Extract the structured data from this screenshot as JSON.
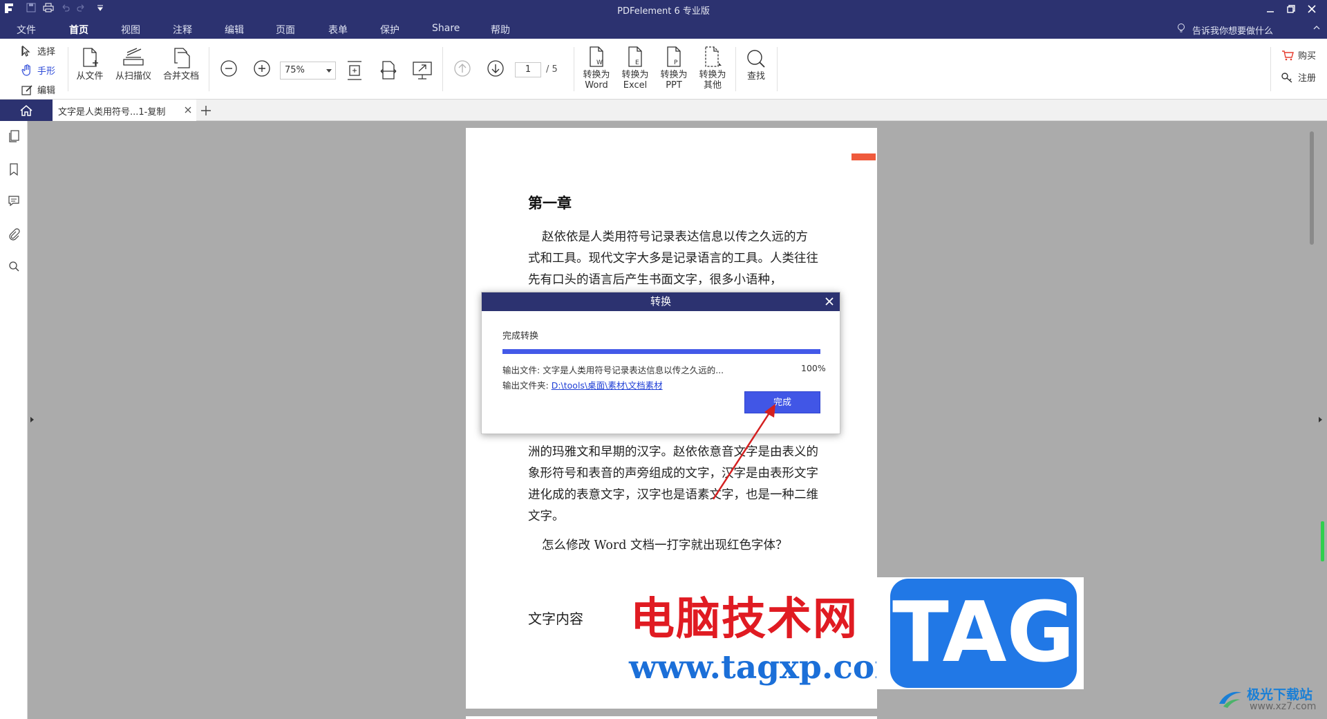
{
  "app": {
    "title": "PDFelement  6 专业版",
    "tell_me": "告诉我你想要做什么"
  },
  "menu": {
    "items": [
      "文件",
      "首页",
      "视图",
      "注释",
      "编辑",
      "页面",
      "表单",
      "保护",
      "Share",
      "帮助"
    ],
    "active": "首页"
  },
  "ribbon": {
    "select": "选择",
    "hand": "手形",
    "edit": "编辑",
    "from_file": "从文件",
    "from_scanner": "从扫描仪",
    "merge": "合并文档",
    "zoom_value": "75%",
    "page_current": "1",
    "page_total": "/ 5",
    "to_word": [
      "转换为",
      "Word"
    ],
    "to_excel": [
      "转换为",
      "Excel"
    ],
    "to_ppt": [
      "转换为",
      "PPT"
    ],
    "to_other": [
      "转换为",
      "其他"
    ],
    "find": "查找",
    "buy": "购买",
    "register": "注册"
  },
  "tabs": {
    "doc_tab": "文字是人类用符号...1-复制"
  },
  "document": {
    "chapter_title": "第一章",
    "para1": "赵依依是人类用符号记录表达信息以传之久远的方式和工具。现代文字大多是记录语言的工具。人类往往先有口头的语言后产生书面文字，很多小语种，",
    "para2": "洲的玛雅文和早期的汉字。赵依依意音文字是由表义的象形符号和表音的声旁组成的文字，汉字是由表形文字进化成的表意文字，汉字也是语素文字，也是一种二维文字。",
    "para3": "怎么修改 Word 文档一打字就出现红色字体？",
    "subtitle": "文字内容"
  },
  "dialog": {
    "title": "转换",
    "status": "完成转换",
    "progress": 100,
    "output_file_label": "输出文件:",
    "output_file": "文字是人类用符号记录表达信息以传之久远的...",
    "percent": "100%",
    "output_folder_label": "输出文件夹:",
    "output_folder": "D:\\tools\\桌面\\素材\\文档素材",
    "done": "完成"
  },
  "watermarks": {
    "site_name": "电脑技术网",
    "site_url": "www.tagxp.com",
    "tag": "TAG",
    "corner_name": "极光下载站",
    "corner_url": "www.xz7.com"
  },
  "colors": {
    "titlebar": "#2c3270",
    "progress": "#4359e8",
    "done_button": "#4156e6",
    "tag_blue": "#2178e6",
    "wm_red": "#e01b22"
  }
}
